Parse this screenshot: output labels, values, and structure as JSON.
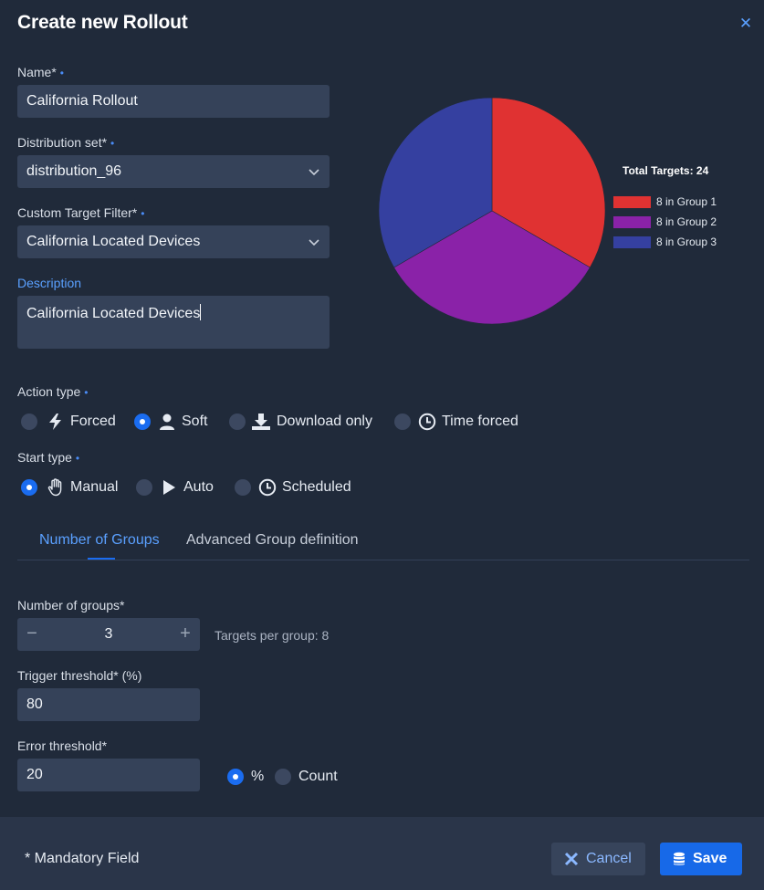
{
  "dialog": {
    "title": "Create new Rollout"
  },
  "form": {
    "name": {
      "label": "Name*",
      "value": "California Rollout"
    },
    "distribution_set": {
      "label": "Distribution set*",
      "value": "distribution_96"
    },
    "custom_target_filter": {
      "label": "Custom Target Filter*",
      "value": "California Located Devices"
    },
    "description": {
      "label": "Description",
      "value": "California Located Devices"
    }
  },
  "action_type": {
    "label": "Action type",
    "options": [
      {
        "label": "Forced",
        "icon": "bolt-icon",
        "selected": false
      },
      {
        "label": "Soft",
        "icon": "user-icon",
        "selected": true
      },
      {
        "label": "Download only",
        "icon": "download-icon",
        "selected": false
      },
      {
        "label": "Time forced",
        "icon": "clock-icon",
        "selected": false
      }
    ]
  },
  "start_type": {
    "label": "Start type",
    "options": [
      {
        "label": "Manual",
        "icon": "hand-icon",
        "selected": true
      },
      {
        "label": "Auto",
        "icon": "play-icon",
        "selected": false
      },
      {
        "label": "Scheduled",
        "icon": "clock-icon",
        "selected": false
      }
    ]
  },
  "tabs": [
    {
      "label": "Number of Groups",
      "active": true
    },
    {
      "label": "Advanced Group definition",
      "active": false
    }
  ],
  "groups": {
    "number_label": "Number of groups*",
    "number_value": "3",
    "targets_per_group": "Targets per group: 8",
    "trigger_label": "Trigger threshold* (%)",
    "trigger_value": "80",
    "error_label": "Error threshold*",
    "error_value": "20",
    "error_unit_options": [
      {
        "label": "%",
        "selected": true
      },
      {
        "label": "Count",
        "selected": false
      }
    ]
  },
  "footer": {
    "mandatory_note": "* Mandatory Field",
    "cancel_label": "Cancel",
    "save_label": "Save"
  },
  "chart_data": {
    "type": "pie",
    "title": "Total Targets: 24",
    "slices": [
      {
        "label": "8 in Group 1",
        "value": 8,
        "color": "#e03232"
      },
      {
        "label": "8 in Group 2",
        "value": 8,
        "color": "#8a22a8"
      },
      {
        "label": "8 in Group 3",
        "value": 8,
        "color": "#3540a0"
      }
    ],
    "legend_position": "right"
  },
  "colors": {
    "accent": "#1a6cf0",
    "background": "#202a3a",
    "field": "#354259"
  }
}
